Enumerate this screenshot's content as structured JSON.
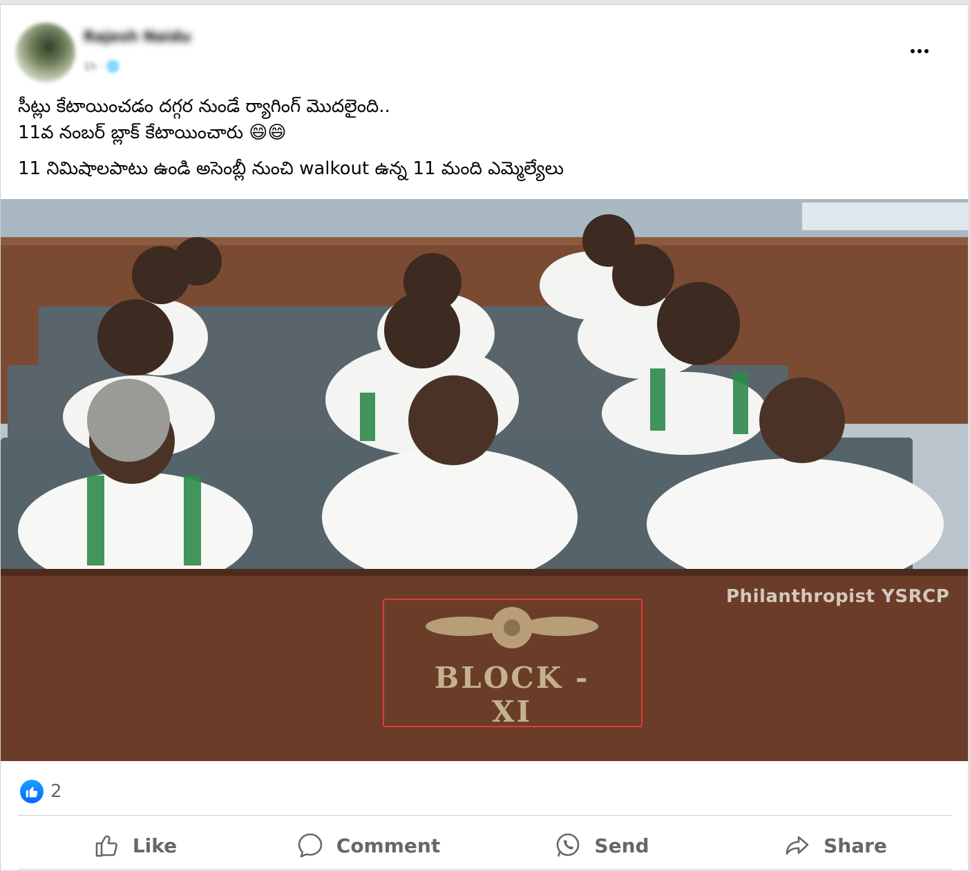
{
  "post": {
    "author": "Rajesh Naidu",
    "time": "1h · 🌐",
    "lines": [
      "సీట్లు కేటాయించడం దగ్గర నుండే ర్యాగింగ్ మొదలైంది..",
      "11వ నంబర్ బ్లాక్ కేటాయించారు 😄😄",
      "11 నిమిషాలపాటు ఉండి అసెంబ్లీ నుంచి walkout  ఉన్న 11 మంది ఎమ్మెల్యేలు"
    ]
  },
  "image": {
    "watermark": "Philanthropist YSRCP",
    "block_label": "BLOCK - XI"
  },
  "reactions": {
    "icon": "like-icon",
    "count": "2"
  },
  "actions": {
    "like": "Like",
    "comment": "Comment",
    "send": "Send",
    "share": "Share"
  },
  "colors": {
    "accent": "#0866ff",
    "secondary_text": "#65676b",
    "highlight_box": "#e23b3b"
  }
}
